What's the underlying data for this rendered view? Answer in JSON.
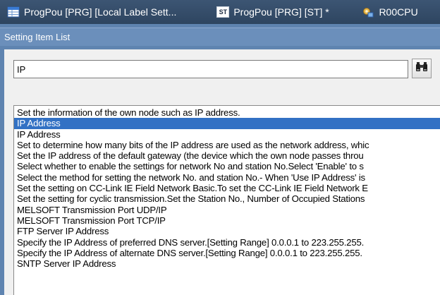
{
  "tabs": [
    {
      "label": "ProgPou [PRG] [Local Label Sett...",
      "icon": "local-label-icon"
    },
    {
      "label": "ProgPou [PRG] [ST] *",
      "icon": "st-program-icon",
      "badge": "ST"
    },
    {
      "label": "R00CPU",
      "icon": "cpu-parameter-icon"
    }
  ],
  "panel": {
    "title": "Setting Item List"
  },
  "search": {
    "value": "IP",
    "button_icon": "binoculars-icon"
  },
  "results": {
    "selected_index": 1,
    "items": [
      "Set the information of the own node such as IP address.",
      "IP Address",
      "IP Address",
      "Set to determine how many bits of the IP address are used as the network address, whic",
      "Set the IP address of the default gateway (the device which the own node passes throu",
      "Select whether to enable the settings for network No and station No.Select 'Enable' to s",
      "Select the method for setting the network No. and station No.- When 'Use IP Address' is",
      "Set the setting on CC-Link IE Field Network Basic.To set the CC-Link IE Field Network E",
      "Set the setting for cyclic transmission.Set the Station No., Number of Occupied Stations",
      "MELSOFT Transmission Port UDP/IP",
      "MELSOFT Transmission Port TCP/IP",
      "FTP Server IP Address",
      "Specify the IP Address of preferred DNS server.[Setting Range] 0.0.0.1 to 223.255.255.",
      "Specify the IP Address of alternate DNS server.[Setting Range] 0.0.0.1 to 223.255.255.",
      "SNTP Server IP Address"
    ]
  },
  "colors": {
    "tab_bar": "#344d6b",
    "panel_frame": "#5f84b0",
    "selection": "#3271c4"
  }
}
